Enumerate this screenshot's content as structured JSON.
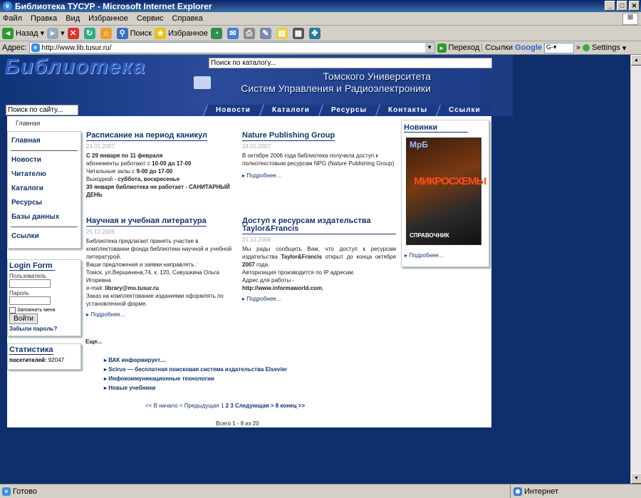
{
  "window": {
    "title": "Библиотека ТУСУР - Microsoft Internet Explorer"
  },
  "menu": [
    "Файл",
    "Правка",
    "Вид",
    "Избранное",
    "Сервис",
    "Справка"
  ],
  "toolbar": {
    "back": "Назад",
    "search": "Поиск",
    "favorites": "Избранное"
  },
  "address": {
    "label": "Адрес:",
    "url": "http://www.lib.tusur.ru/",
    "go": "Переход",
    "links": "Ссылки",
    "google": "Google",
    "settings": "Settings"
  },
  "header": {
    "title": "Библиотека",
    "university_line1": "Томского Университета",
    "university_line2": "Систем Управления и Радиоэлектроники",
    "catalog_search": "Поиск по каталогу...",
    "site_search": "Поиск по сайту...",
    "nav": [
      "Новости",
      "Каталоги",
      "Ресурсы",
      "Контакты",
      "Ссылки"
    ]
  },
  "breadcrumb": "Главная",
  "sidebar": {
    "items": [
      "Главная",
      "Новости",
      "Читателю",
      "Каталоги",
      "Ресурсы",
      "Базы данных",
      "Ссылки"
    ],
    "login_title": "Login Form",
    "user_label": "Пользователь",
    "pass_label": "Пароль",
    "remember": "Запомнить меня",
    "login_btn": "Войти",
    "forgot": "Забыли пароль?",
    "stats_title": "Статистика",
    "visitors_label": "посетителей:",
    "visitors_count": "92047"
  },
  "news": [
    {
      "title": "Расписание на период каникул",
      "date": "24.01.2007"
    },
    {
      "title": "Nature Publishing Group",
      "date": "18.01.2007",
      "body": "В октябре 2006 года библиотека получила доступ к полнотекстовым ресурсам NPG (Nature Publishing Group)",
      "more": "Подробнее..."
    },
    {
      "title": "Научная и учебная литература",
      "date": "25.12.2006",
      "more": "Подробнее..."
    },
    {
      "title": "Доступ к ресурсам издательства Taylor&Francis",
      "date": "21.12.2006",
      "more": "Подробнее..."
    }
  ],
  "news1_lines": {
    "l1a": "С 29 января по 11 февраля",
    "l2a": "абонементы работают с ",
    "l2b": "10-00 до 17-00",
    "l3a": "Читальные залы с ",
    "l3b": "9-00 до 17-00",
    "l4a": "Выходной - ",
    "l4b": "суббота, воскресенье",
    "l5": "30 января библиотека не работает - САНИТАРНЫЙ ДЕНЬ"
  },
  "news3_lines": {
    "p1": "Библиотека предлагает принять участие в комплектовании фонда библиотеки научной и учебной литературой.",
    "p2": "Ваши предложения и заявки направлять :",
    "p3": "Томск, ул.Вершинина,74, к. 120, Савушкина Ольга Игоревна",
    "p4a": "e-mail: ",
    "p4b": "library@ms.tusur.ru",
    "p5": "Заказ на комплектование изданиями оформлять по установленной форме."
  },
  "news4_lines": {
    "a": "Мы рады сообщить Вам, что доступ к ресурсам издательства ",
    "b": "Taylor&Francis",
    "c": " открыт до конца октября ",
    "d": "2007",
    "e": " года.",
    "f": "Авторизация производится по IP адресам.",
    "g": "Адрес для работы -",
    "h": "http://www.informaworld.com",
    "i": ","
  },
  "more_label": "Еще...",
  "more_links": [
    "ВАК информирует....",
    "Scirus — бесплатная поисковая система издательства Elsevier",
    "Инфокоммуникационные технологии",
    "Новые учебники"
  ],
  "pagination": {
    "first": "<< В начало",
    "prev": "< Предыдущая",
    "p1": "1",
    "p2": "2",
    "p3": "3",
    "next": "Следующая >",
    "last": "8 конец >>",
    "total": "Всего 1 - 8 из 20"
  },
  "novinki": {
    "title": "Новинки",
    "more": "Подробнее...",
    "cover1": "МрБ",
    "cover2": "МИКРОСХЕМЫ",
    "cover3": "СПРАВОЧНИК"
  },
  "status": {
    "left": "Готово",
    "zone": "Интернет"
  }
}
